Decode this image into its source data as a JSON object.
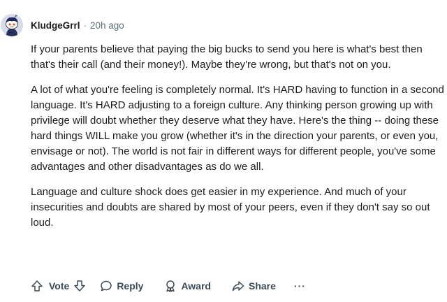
{
  "comment": {
    "author": "KludgeGrrl",
    "separator": "·",
    "timestamp": "20h ago",
    "paragraphs": [
      "If your parents believe that paying the big bucks to send you here is what's best then that's their call (and their money!). Maybe they're wrong, but that's not on you.",
      "A lot of what you're feeling is completely normal. It's HARD having to function in a second language. It's HARD adjusting to a foreign culture. Any thinking person growing up with privilege will doubt whether they deserve what they have. Here's the thing -- doing these hard things WILL make you grow (whether it's in the direction your parents, or even you, envisage or not). The world is not fair in different ways for different people, you've some advantages and other disadvantages as do we all.",
      "Language and culture shock does get easier in my experience. And much of your insecurities and doubts are shared by most of your peers, even if they don't say so out loud."
    ]
  },
  "actions": {
    "vote_label": "Vote",
    "reply_label": "Reply",
    "award_label": "Award",
    "share_label": "Share",
    "more_label": "···"
  },
  "icons": {
    "avatar": "snoo-avatar-icon",
    "upvote": "upvote-arrow-icon",
    "downvote": "downvote-arrow-icon",
    "reply": "speech-bubble-icon",
    "award": "award-medal-icon",
    "share": "share-arrow-icon",
    "more": "ellipsis-icon"
  },
  "colors": {
    "text": "#1c1c1c",
    "meta": "#576f76",
    "action": "#3c4a56",
    "avatar_bg": "#d6dde8"
  }
}
